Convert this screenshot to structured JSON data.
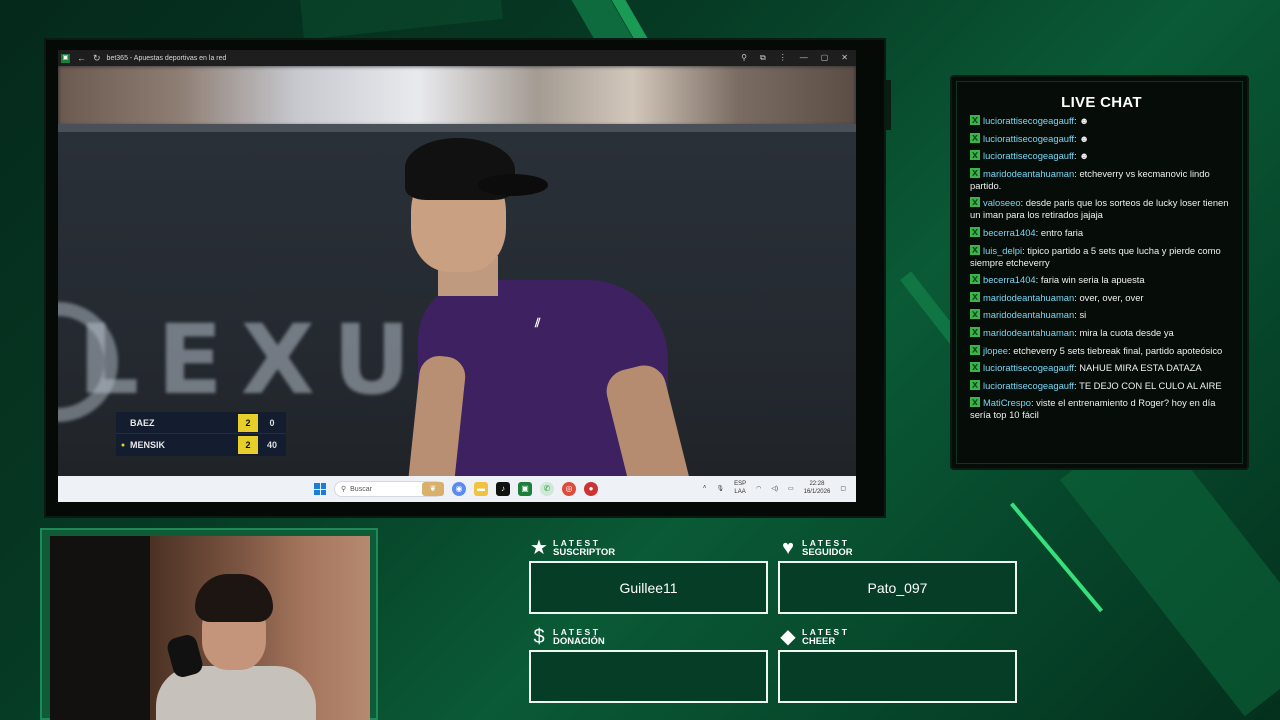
{
  "browser": {
    "title": "bet365 - Apuestas deportivas en la red",
    "icon_name": "bet365-icon"
  },
  "scoreboard": {
    "players": [
      {
        "name": "BAEZ",
        "sets": "2",
        "games": "0",
        "serving": false
      },
      {
        "name": "MENSIK",
        "sets": "2",
        "games": "40",
        "serving": true
      }
    ],
    "video_brand": "LEXUS"
  },
  "taskbar": {
    "search_placeholder": "Buscar",
    "lang_top": "ESP",
    "lang_bottom": "LAA",
    "time": "22:28",
    "date": "16/1/2026"
  },
  "chat": {
    "title": "LIVE CHAT",
    "messages": [
      {
        "user": "luciorattisecogeagauff",
        "text": ""
      },
      {
        "user": "luciorattisecogeagauff",
        "text": ""
      },
      {
        "user": "luciorattisecogeagauff",
        "text": ""
      },
      {
        "user": "maridodeantahuaman",
        "text": "etcheverry vs kecmanovic lindo partido."
      },
      {
        "user": "valoseeo",
        "text": "desde paris que los sorteos de lucky loser tienen un iman para los retirados jajaja"
      },
      {
        "user": "becerra1404",
        "text": "entro faria"
      },
      {
        "user": "luis_delpi",
        "text": "tipico partido a 5 sets que lucha y pierde como siempre etcheverry"
      },
      {
        "user": "becerra1404",
        "text": "faria win seria la apuesta"
      },
      {
        "user": "maridodeantahuaman",
        "text": "over, over, over"
      },
      {
        "user": "maridodeantahuaman",
        "text": "si"
      },
      {
        "user": "maridodeantahuaman",
        "text": "mira la cuota desde ya"
      },
      {
        "user": "jlopee",
        "text": "etcheverry 5 sets tiebreak final, partido apoteósico"
      },
      {
        "user": "luciorattisecogeagauff",
        "text": "NAHUE MIRA ESTA DATAZA"
      },
      {
        "user": "luciorattisecogeagauff",
        "text": "TE DEJO CON EL CULO AL AIRE"
      },
      {
        "user": "MatiCrespo",
        "text": "viste el entrenamiento d Roger? hoy en día sería top 10 fácil"
      }
    ]
  },
  "alerts": {
    "suscriptor": {
      "small": "LATEST",
      "big": "SUSCRIPTOR",
      "value": "Guillee11",
      "icon": "star-icon"
    },
    "seguidor": {
      "small": "LATEST",
      "big": "SEGUIDOR",
      "value": "Pato_097",
      "icon": "heart-icon"
    },
    "donacion": {
      "small": "LATEST",
      "big": "DONACIÓN",
      "value": "",
      "icon": "dollar-icon"
    },
    "cheer": {
      "small": "LATEST",
      "big": "CHEER",
      "value": "",
      "icon": "diamond-icon"
    }
  },
  "colors": {
    "accent_green": "#3bb54a",
    "score_yellow": "#e6cf2a",
    "chat_username": "#7ad6f5",
    "background_dark": "#05291b"
  }
}
